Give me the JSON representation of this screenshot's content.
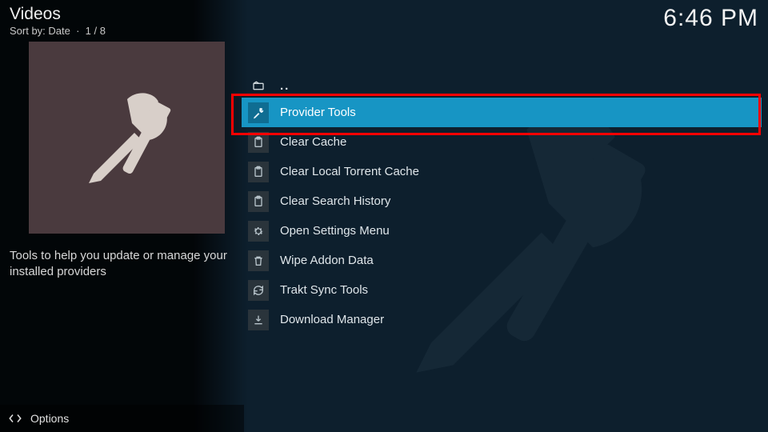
{
  "header": {
    "title": "Videos",
    "sort_label": "Sort by: Date",
    "position": "1 / 8",
    "clock": "6:46 PM"
  },
  "sidebar": {
    "description": "Tools to help you update or manage your installed providers"
  },
  "list": {
    "parent_label": "..",
    "items": [
      {
        "label": "Provider Tools",
        "icon": "tools",
        "selected": true
      },
      {
        "label": "Clear Cache",
        "icon": "clipboard",
        "selected": false
      },
      {
        "label": "Clear Local Torrent Cache",
        "icon": "clipboard",
        "selected": false
      },
      {
        "label": "Clear Search History",
        "icon": "clipboard",
        "selected": false
      },
      {
        "label": "Open Settings Menu",
        "icon": "gear",
        "selected": false
      },
      {
        "label": "Wipe Addon Data",
        "icon": "trash",
        "selected": false
      },
      {
        "label": "Trakt Sync Tools",
        "icon": "sync",
        "selected": false
      },
      {
        "label": "Download Manager",
        "icon": "download",
        "selected": false
      }
    ]
  },
  "footer": {
    "options_label": "Options"
  }
}
